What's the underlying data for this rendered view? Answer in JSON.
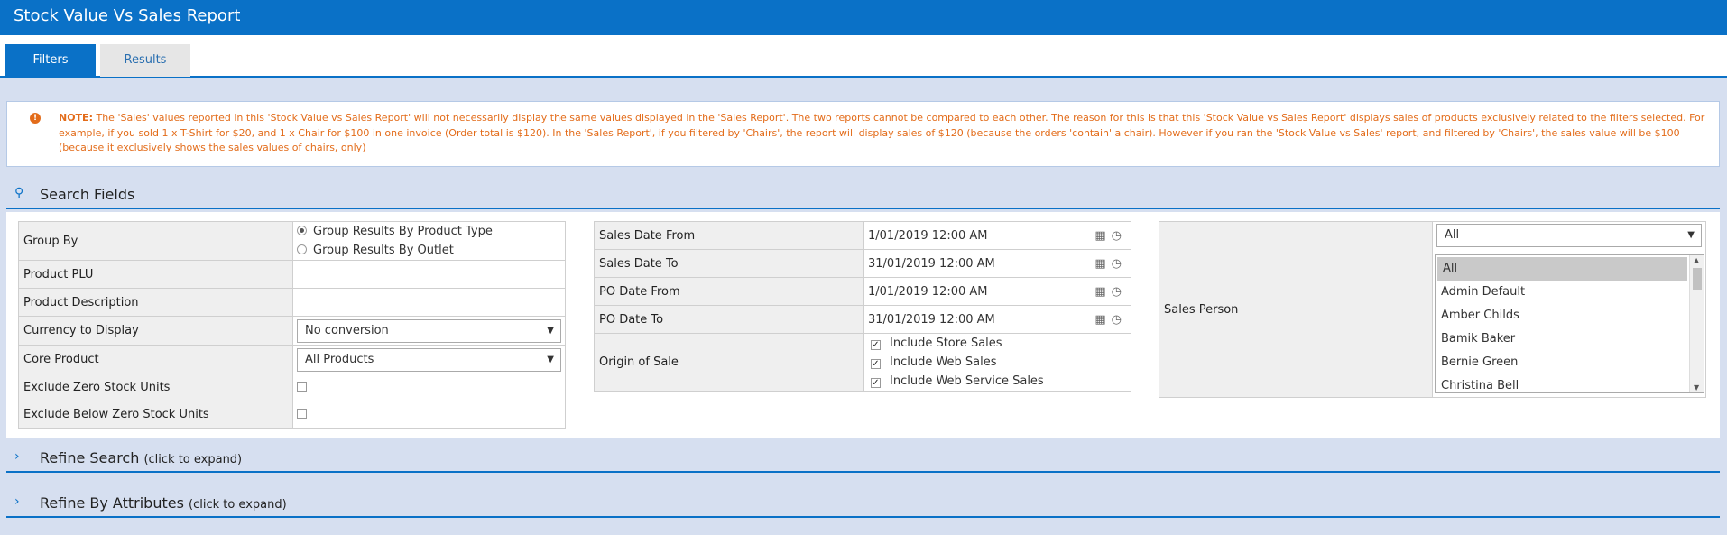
{
  "window": {
    "title": "Stock Value Vs Sales Report"
  },
  "tabs": [
    {
      "label": "Filters"
    },
    {
      "label": "Results"
    }
  ],
  "note": {
    "icon": "exclamation-icon",
    "lead": "NOTE:",
    "text": "The 'Sales' values reported in this 'Stock Value vs Sales Report' will not necessarily display the same values displayed in the 'Sales Report'. The two reports cannot be compared to each other. The reason for this is that this 'Stock Value vs Sales Report' displays sales of products exclusively related to the filters selected. For example, if you sold 1 x T-Shirt for $20, and 1 x Chair for $100 in one invoice (Order total is $120). In the 'Sales Report', if you filtered by 'Chairs', the report will display sales of $120 (because the orders 'contain' a chair). However if you ran the 'Stock Value vs Sales' report, and filtered by 'Chairs', the sales value will be $100 (because it exclusively shows the sales values of chairs, only)"
  },
  "search_fields": {
    "title": "Search Fields",
    "group_by": {
      "label": "Group By",
      "options": [
        "Group Results By Product Type",
        "Group Results By Outlet"
      ],
      "selected": "Group Results By Product Type"
    },
    "product_plu": {
      "label": "Product PLU",
      "value": ""
    },
    "product_description": {
      "label": "Product Description",
      "value": ""
    },
    "currency": {
      "label": "Currency to Display",
      "value": "No conversion"
    },
    "core_product": {
      "label": "Core Product",
      "value": "All Products"
    },
    "exclude_zero": {
      "label": "Exclude Zero Stock Units",
      "checked": false
    },
    "exclude_below_zero": {
      "label": "Exclude Below Zero Stock Units",
      "checked": false
    },
    "sales_date_from": {
      "label": "Sales Date From",
      "value": "1/01/2019 12:00 AM"
    },
    "sales_date_to": {
      "label": "Sales Date To",
      "value": "31/01/2019 12:00 AM"
    },
    "po_date_from": {
      "label": "PO Date From",
      "value": "1/01/2019 12:00 AM"
    },
    "po_date_to": {
      "label": "PO Date To",
      "value": "31/01/2019 12:00 AM"
    },
    "origin_of_sale": {
      "label": "Origin of Sale",
      "options": [
        {
          "label": "Include Store Sales",
          "checked": true
        },
        {
          "label": "Include Web Sales",
          "checked": true
        },
        {
          "label": "Include Web Service Sales",
          "checked": true
        }
      ]
    },
    "sales_person": {
      "label": "Sales Person",
      "dropdown_value": "All",
      "list": [
        "All",
        "Admin Default",
        "Amber Childs",
        "Bamik Baker",
        "Bernie Green",
        "Christina Bell"
      ],
      "selected": "All"
    }
  },
  "refine_search": {
    "title": "Refine Search",
    "hint": "(click to expand)"
  },
  "refine_attributes": {
    "title": "Refine By Attributes",
    "hint": "(click to expand)"
  }
}
